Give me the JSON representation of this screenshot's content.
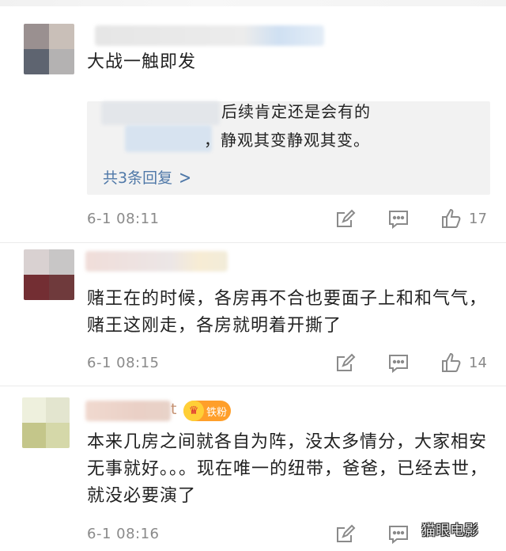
{
  "comments": [
    {
      "text": "大战一触即发",
      "replies_preview": {
        "line1": "后续肯定还是会有的",
        "line2": "，静观其变静观其变。",
        "more": "共3条回复"
      },
      "time": "6-1 08:11",
      "likes": "17"
    },
    {
      "text": "赌王在的时候，各房再不合也要面子上和和气气，赌王这刚走，各房就明着开撕了",
      "time": "6-1 08:15",
      "likes": "14"
    },
    {
      "name_fragment": "t",
      "badge": "铁粉",
      "text": "本来几房之间就各自为阵，没太多情分，大家相安无事就好。。。现在唯一的纽带，爸爸，已经去世，就没必要演了",
      "time": "6-1 08:16"
    }
  ],
  "watermark": "猫眼电影",
  "icons": {
    "reply": "reply-icon",
    "comment": "comment-icon",
    "like": "like-icon",
    "more": "chevron-right-icon",
    "badge": "crown-icon"
  },
  "colors": {
    "link": "#4f78a8",
    "meta": "#8a8a8a",
    "badge": "#ff9f2a",
    "reply_bg": "#f2f2f2"
  }
}
